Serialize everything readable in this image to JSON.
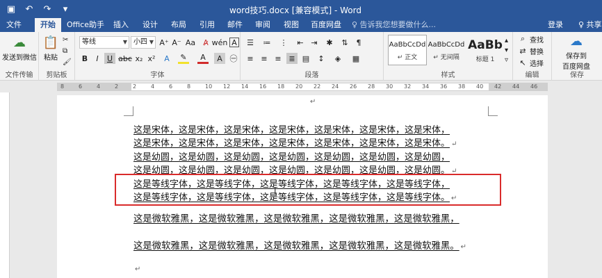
{
  "window": {
    "title": "word技巧.docx [兼容模式] - Word"
  },
  "qat": {
    "save_icon": "save-icon",
    "undo_icon": "undo-icon",
    "redo_icon": "redo-icon"
  },
  "tabs": [
    {
      "label": "文件"
    },
    {
      "label": "开始"
    },
    {
      "label": "Office助手"
    },
    {
      "label": "插入"
    },
    {
      "label": "设计"
    },
    {
      "label": "布局"
    },
    {
      "label": "引用"
    },
    {
      "label": "邮件"
    },
    {
      "label": "审阅"
    },
    {
      "label": "视图"
    },
    {
      "label": "百度网盘"
    }
  ],
  "tell_me": "♀ 告诉我您想要做什么...",
  "login": "登录",
  "share": "♀ 共享",
  "ribbon": {
    "send_wechat": "发送到微信",
    "file_transfer": "文件传输",
    "paste": "粘贴",
    "clipboard": "剪贴板",
    "font_name": "等线",
    "font_size": "小四",
    "font_group": "字体",
    "paragraph_group": "段落",
    "styles_group": "样式",
    "styles": [
      {
        "sample": "AaBbCcDd",
        "name": "↵ 正文"
      },
      {
        "sample": "AaBbCcDd",
        "name": "↵ 无间隔"
      },
      {
        "sample": "AaBb",
        "name": "标题 1"
      }
    ],
    "find": "查找",
    "replace": "替换",
    "select": "选择",
    "edit_group": "编辑",
    "save_baidu_line1": "保存到",
    "save_baidu_line2": "百度网盘",
    "save_group": "保存"
  },
  "ruler_labels": [
    "8",
    "6",
    "4",
    "2",
    "2",
    "4",
    "6",
    "8",
    "10",
    "12",
    "14",
    "16",
    "18",
    "20",
    "22",
    "24",
    "26",
    "28",
    "30",
    "32",
    "34",
    "36",
    "38",
    "40",
    "42",
    "44",
    "46"
  ],
  "document": {
    "top_mark": "↵",
    "lines": [
      {
        "text": "这是宋体，这是宋体，这是宋体，这是宋体，这是宋体，这是宋体，这是宋体，",
        "mark": ""
      },
      {
        "text": "这是宋体，这是宋体，这是宋体，这是宋体，这是宋体，这是宋体，这是宋体。",
        "mark": "↵"
      },
      {
        "text": "这是幼圆，这是幼圆，这是幼圆，这是幼圆，这是幼圆，这是幼圆，这是幼圆，",
        "mark": ""
      },
      {
        "text": "这是幼圆，这是幼圆，这是幼圆，这是幼圆，这是幼圆，这是幼圆，这是幼圆。",
        "mark": "↵"
      },
      {
        "text": "这是等线字体，这是等线字体，这是等线字体，这是等线字体，这是等线字体，",
        "mark": ""
      },
      {
        "text": "这是等线字体，这是等线字体，这是等线字体，这是等线字体，这是等线字体。",
        "mark": "↵"
      },
      {
        "text": "这是微软雅黑，这是微软雅黑，这是微软雅黑，这是微软雅黑，这是微软雅黑，",
        "mark": ""
      },
      {
        "text": "这是微软雅黑，这是微软雅黑，这是微软雅黑，这是微软雅黑，这是微软雅黑。",
        "mark": "↵"
      }
    ],
    "bottom_mark": "↵"
  },
  "colors": {
    "accent": "#2b579a",
    "highlight_box": "#d92b2b"
  }
}
